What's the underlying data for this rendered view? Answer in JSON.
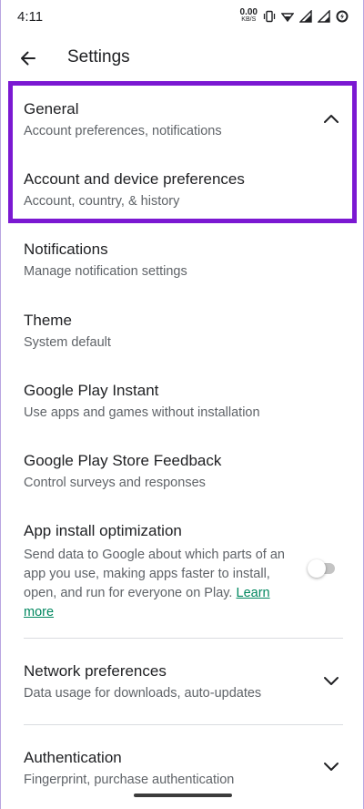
{
  "status_bar": {
    "time": "4:11",
    "net_speed_value": "0.00",
    "net_speed_unit": "KB/S",
    "icons": [
      "vibrate-icon",
      "wifi-icon",
      "signal-icon",
      "signal-icon",
      "data-saver-icon"
    ]
  },
  "app_bar": {
    "title": "Settings"
  },
  "sections": {
    "general": {
      "title": "General",
      "subtitle": "Account preferences, notifications",
      "expanded": true
    },
    "account_device": {
      "title": "Account and device preferences",
      "subtitle": "Account, country, & history"
    },
    "notifications": {
      "title": "Notifications",
      "subtitle": "Manage notification settings"
    },
    "theme": {
      "title": "Theme",
      "subtitle": "System default"
    },
    "play_instant": {
      "title": "Google Play Instant",
      "subtitle": "Use apps and games without installation"
    },
    "feedback": {
      "title": "Google Play Store Feedback",
      "subtitle": "Control surveys and responses"
    },
    "install_optimization": {
      "title": "App install optimization",
      "desc_line1": "Send data to Google about which parts of an",
      "desc_line2": "app you use, making apps faster to install,",
      "desc_line3": "open, and run for everyone on Play.",
      "learn_more_1": "Learn",
      "learn_more_2": "more",
      "toggle_on": false
    },
    "network": {
      "title": "Network preferences",
      "subtitle": "Data usage for downloads, auto-updates",
      "expanded": false
    },
    "authentication": {
      "title": "Authentication",
      "subtitle": "Fingerprint, purchase authentication",
      "expanded": false
    }
  },
  "colors": {
    "highlight_border": "#7b18d2",
    "link": "#01875f",
    "text_primary": "#202124",
    "text_secondary": "#5f6368"
  }
}
